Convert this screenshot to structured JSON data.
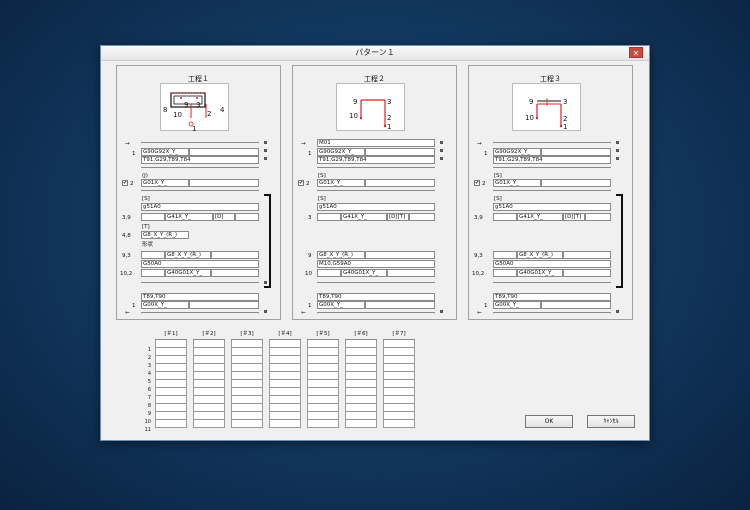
{
  "window": {
    "title": "パターン１",
    "close": "✕"
  },
  "panels": [
    {
      "label": "工程１",
      "start_arrow": "→",
      "end_arrow": "←",
      "rows": [
        {
          "num": "1",
          "lines": [
            "G90G92X_Y_",
            "T91,G29,T89,T84"
          ]
        },
        {
          "text": "(J)"
        },
        {
          "check": "✔",
          "num": "2",
          "lines": [
            "G01X_Y_"
          ]
        },
        {
          "text": "[S]"
        },
        {
          "lines": [
            "g51A0"
          ]
        },
        {
          "num": "3,9",
          "fields": [
            "G41X_Y_",
            "[D]"
          ]
        },
        {
          "text": "[T]"
        },
        {
          "num": "4,8",
          "lines": [
            "G8_X_Y_(R_)"
          ]
        },
        {
          "text": "形状"
        },
        {
          "num": "9,3",
          "fields": [
            "G8_X_Y_(R_)"
          ]
        },
        {
          "lines": [
            "G50A0"
          ]
        },
        {
          "num": "10,2",
          "fields": [
            "G40G01X_Y_"
          ]
        },
        {
          "lines": [
            "T89,T90"
          ]
        },
        {
          "num": "1",
          "lines": [
            "G00X_Y_"
          ]
        }
      ],
      "diagram_labels": [
        "1",
        "2",
        "3",
        "4",
        "8",
        "9",
        "10"
      ]
    },
    {
      "label": "工程２",
      "start_arrow": "→",
      "end_arrow": "←",
      "rows": [
        {
          "lines": [
            "M01"
          ]
        },
        {
          "num": "1",
          "lines": [
            "G90G92X_Y_",
            "T91,G29,T89,T84"
          ]
        },
        {
          "text": "[S]"
        },
        {
          "check": "✔",
          "num": "2",
          "lines": [
            "G01X_Y_"
          ]
        },
        {
          "text": "[S]"
        },
        {
          "lines": [
            "g51A0"
          ]
        },
        {
          "num": "3",
          "fields": [
            "G41X_Y_",
            "[D][T]"
          ]
        },
        {
          "num": "9",
          "lines": [
            "G8_X_Y_(R_)"
          ]
        },
        {
          "lines": [
            "M10,G59A0"
          ]
        },
        {
          "num": "10",
          "fields": [
            "G40G01X_Y_"
          ]
        },
        {
          "lines": [
            "T89,T90"
          ]
        },
        {
          "num": "1",
          "lines": [
            "G00X_Y_"
          ]
        }
      ],
      "diagram_labels": [
        "1",
        "2",
        "3",
        "9",
        "10"
      ]
    },
    {
      "label": "工程３",
      "start_arrow": "→",
      "end_arrow": "←",
      "rows": [
        {
          "num": "1",
          "lines": [
            "G90G92X_Y_",
            "T91,G29,T89,T84"
          ]
        },
        {
          "text": "[S]"
        },
        {
          "check": "✔",
          "num": "2",
          "lines": [
            "G01X_Y_"
          ]
        },
        {
          "text": "[S]"
        },
        {
          "lines": [
            "g51A0"
          ]
        },
        {
          "num": "3,9",
          "fields": [
            "G41X_Y_",
            "[D][T]"
          ]
        },
        {
          "num": "9,3",
          "fields": [
            "G8_X_Y_(R_)"
          ]
        },
        {
          "lines": [
            "G50A0"
          ]
        },
        {
          "num": "10,2",
          "fields": [
            "G40G01X_Y_"
          ]
        },
        {
          "lines": [
            "T89,T90"
          ]
        },
        {
          "num": "1",
          "lines": [
            "G00X_Y_"
          ]
        }
      ],
      "diagram_labels": [
        "1",
        "2",
        "3",
        "9",
        "10"
      ]
    }
  ],
  "grid": {
    "columns": [
      "[＃1]",
      "[＃2]",
      "[＃3]",
      "[＃4]",
      "[＃5]",
      "[＃6]",
      "[＃7]"
    ],
    "rows": [
      "1",
      "2",
      "3",
      "4",
      "5",
      "6",
      "7",
      "8",
      "9",
      "10",
      "11"
    ]
  },
  "buttons": {
    "ok": "OK",
    "cancel": "ｷｬﾝｾﾙ"
  }
}
